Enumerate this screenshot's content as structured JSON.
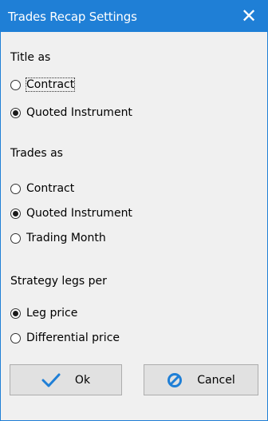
{
  "window": {
    "title": "Trades Recap Settings",
    "close_glyph": "✕"
  },
  "title_group": {
    "label": "Title as",
    "options": [
      {
        "label": "Contract",
        "checked": false
      },
      {
        "label": "Quoted Instrument",
        "checked": true
      }
    ]
  },
  "trades_group": {
    "label": "Trades as",
    "options": [
      {
        "label": "Contract",
        "checked": false
      },
      {
        "label": "Quoted Instrument",
        "checked": true
      },
      {
        "label": "Trading Month",
        "checked": false
      }
    ]
  },
  "legs_group": {
    "label": "Strategy legs per",
    "options": [
      {
        "label": "Leg price",
        "checked": true
      },
      {
        "label": "Differential price",
        "checked": false
      }
    ]
  },
  "buttons": {
    "ok_label": "Ok",
    "cancel_label": "Cancel",
    "ok_icon": "checkmark-icon",
    "cancel_icon": "prohibited-icon"
  },
  "colors": {
    "titlebar": "#1f7fd6",
    "icon_blue": "#1f7fd6",
    "dialog_bg": "#f0f0f0"
  }
}
